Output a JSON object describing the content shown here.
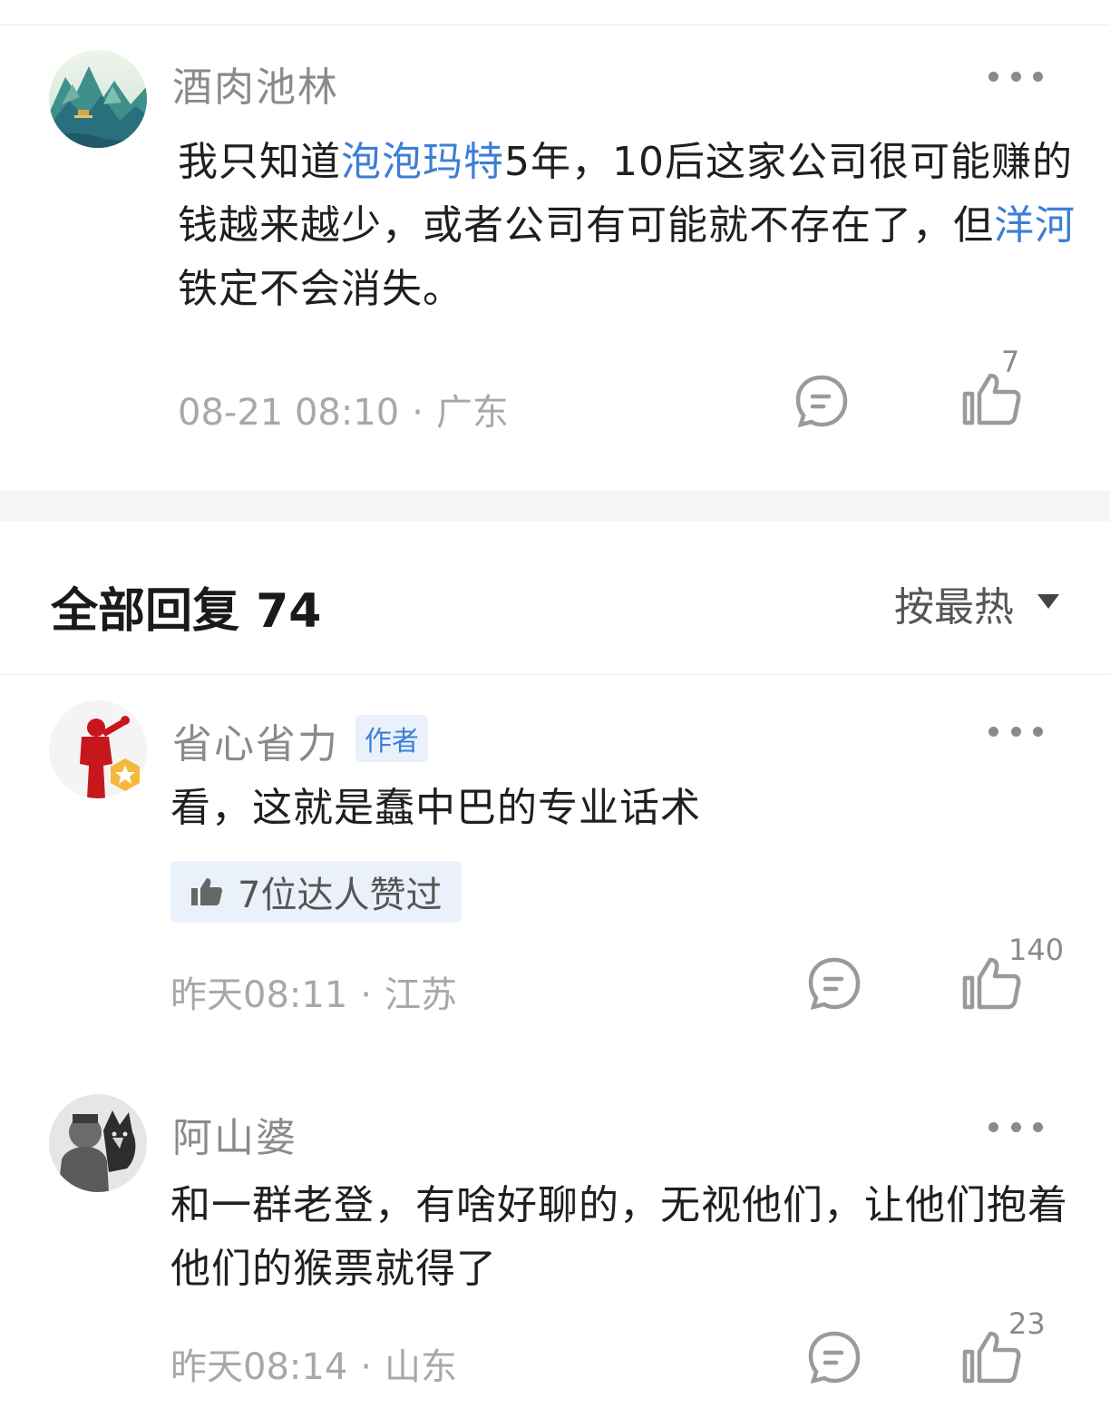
{
  "comments": [
    {
      "username": "酒肉池林",
      "content_parts": [
        "我只知道",
        "泡泡玛特",
        "5年，10后这家公司很可能赚的钱越来越少，或者公司有可能就不存在了，但",
        "洋河",
        "铁定不会消失。"
      ],
      "time": "08-21 08:10",
      "location": "广东",
      "likes": "7"
    }
  ],
  "replies_header": {
    "title": "全部回复 74",
    "sort_label": "按最热"
  },
  "replies": [
    {
      "username": "省心省力",
      "badge": "作者",
      "content": "看，这就是蠢中巴的专业话术",
      "liked_by": "7位达人赞过",
      "time": "昨天08:11",
      "location": "江苏",
      "likes": "140"
    },
    {
      "username": "阿山婆",
      "content": "和一群老登，有啥好聊的，无视他们，让他们抱着他们的猴票就得了",
      "time": "昨天08:14",
      "location": "山东",
      "likes": "23"
    }
  ],
  "meta_separator": "·",
  "colors": {
    "link": "#3d7ed6",
    "meta": "#a8a8a8",
    "username": "#8a8a8a",
    "badge_bg": "#eaf1fb",
    "divider": "#f4f5f7"
  }
}
